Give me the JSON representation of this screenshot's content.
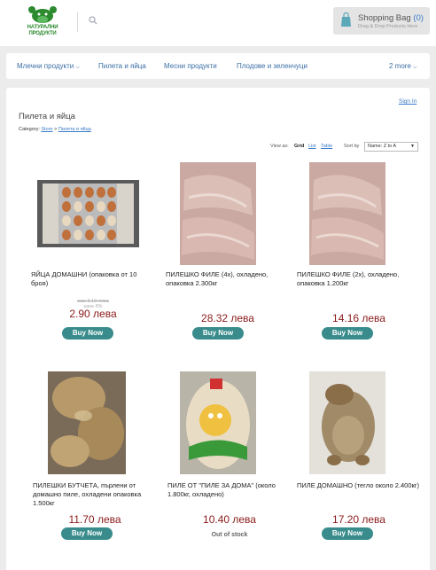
{
  "header": {
    "logo_text": "НАТУРАЛНИ ПРОДУКТИ",
    "bag_title": "Shopping Bag",
    "bag_count": "(0)",
    "bag_hint": "Drag & Drop Products Here"
  },
  "nav": {
    "items": [
      {
        "label": "Млечни продукти",
        "has_chevron": true
      },
      {
        "label": "Пилета и яйца"
      },
      {
        "label": "Месни продукти"
      },
      {
        "label": "Плодове и зеленчуци"
      },
      {
        "label": "2 more",
        "has_chevron": true
      }
    ]
  },
  "page": {
    "sign_in": "Sign In",
    "title": "Пилета и яйца",
    "crumb_prefix": "Category:",
    "crumb_store": "Store",
    "crumb_sep": ">",
    "crumb_current": "Пилета и яйца",
    "view_as": "View as:",
    "view_grid": "Grid",
    "view_list": "List",
    "view_table": "Table",
    "sort_by": "Sort by",
    "sort_value": "Name: Z to A"
  },
  "products": [
    {
      "name": "ЯЙЦА ДОМАШНИ (опаковка от 10 броя)",
      "was": "was 3.10 лева",
      "save": "save 6%",
      "price": "2.90 лева",
      "buy": "Buy Now",
      "image": "eggs"
    },
    {
      "name": "ПИЛЕШКО ФИЛЕ (4x), охладено, опаковка 2.300кг",
      "price": "28.32 лева",
      "buy": "Buy Now",
      "image": "fillet"
    },
    {
      "name": "ПИЛЕШКО ФИЛЕ (2x), охладено, опаковка 1.200кг",
      "price": "14.16 лева",
      "buy": "Buy Now",
      "image": "fillet"
    },
    {
      "name": "ПИЛЕШКИ БУТЧЕТА, пърлени от домашно пиле, охладени опаковка 1.500кг",
      "price": "11.70 лева",
      "buy": "Buy Now",
      "image": "legs"
    },
    {
      "name": "ПИЛЕ ОТ \"ПИЛЕ ЗА ДОМА\" (около 1.800кг, охладено)",
      "price": "10.40 лева",
      "status": "Out of stock",
      "image": "packaged-chicken"
    },
    {
      "name": "ПИЛЕ ДОМАШНО (тегло около 2.400кг)",
      "price": "17.20 лева",
      "buy": "Buy Now",
      "image": "roasted-chicken"
    }
  ],
  "colors": {
    "accent": "#3a8c8c",
    "price": "#8b1a1a",
    "link": "#3a7bc8",
    "logo": "#2c8a2f"
  }
}
